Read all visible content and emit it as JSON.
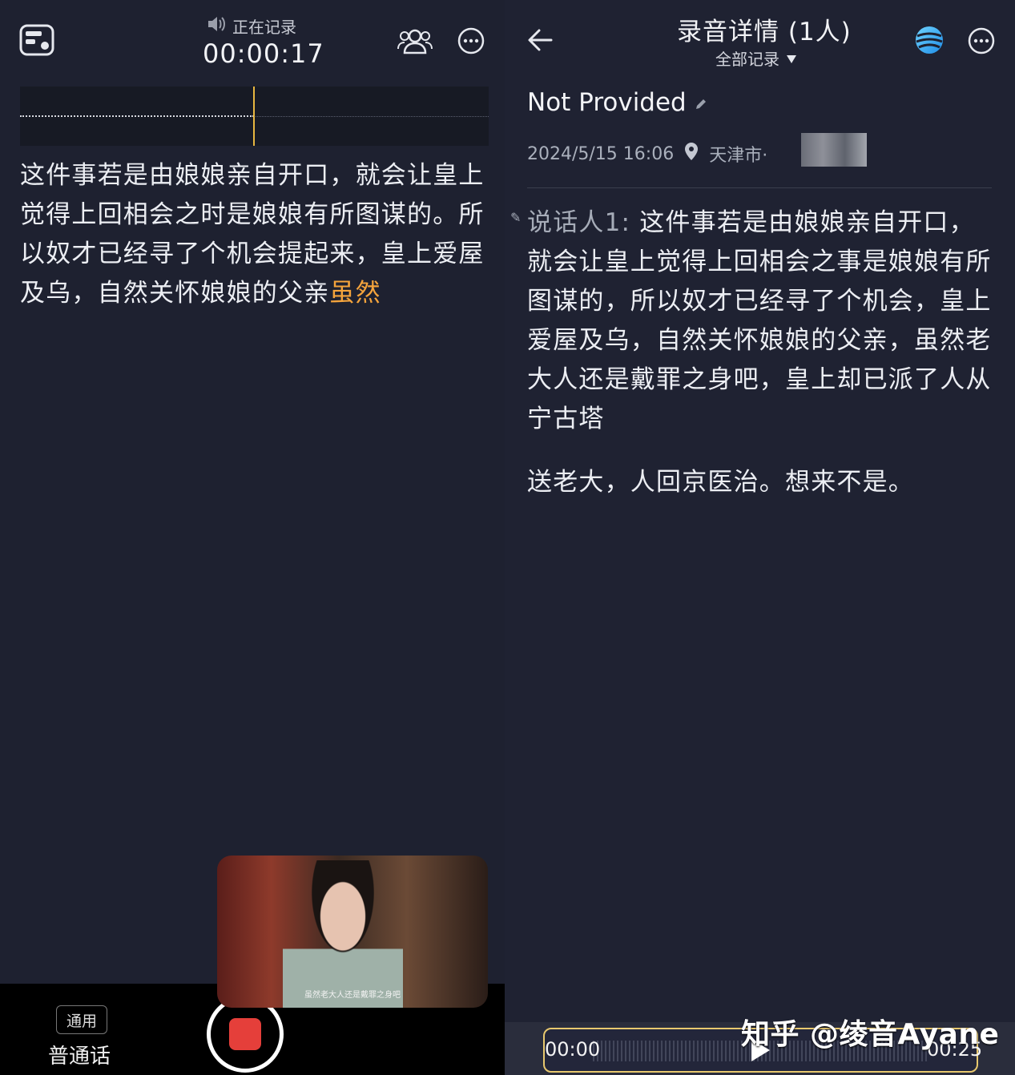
{
  "left": {
    "status": "正在记录",
    "timer": "00:00:17",
    "live_text": "这件事若是由娘娘亲自开口，就会让皇上觉得上回相会之时是娘娘有所图谋的。所以奴才已经寻了个机会提起来，皇上爱屋及乌，自然关怀娘娘的父亲",
    "live_text_highlight": "虽然",
    "language_badge": "通用",
    "language": "普通话",
    "video_subtitle": "虽然老大人还是戴罪之身吧"
  },
  "right": {
    "title": "录音详情 (1人)",
    "filter": "全部记录",
    "name": "Not Provided",
    "datetime": "2024/5/15 16:06",
    "location": "天津市·",
    "speaker_label": "说话人1:",
    "transcript": "这件事若是由娘娘亲自开口，就会让皇上觉得上回相会之事是娘娘有所图谋的，所以奴才已经寻了个机会，皇上爱屋及乌，自然关怀娘娘的父亲，虽然老大人还是戴罪之身吧，皇上却已派了人从宁古塔",
    "transcript2": "送老大，人回京医治。想来不是。",
    "player_start": "00:00",
    "player_end": "00:25"
  },
  "watermark": "知乎 @绫音Ayane",
  "colors": {
    "background": "#1e2130",
    "highlight": "#f5a43c",
    "record": "#e53f3a",
    "timeline_cursor": "#e7b640"
  },
  "icons": [
    "layout-icon",
    "speaker-icon",
    "people-icon",
    "more-icon",
    "back-icon",
    "ai-assistant-icon",
    "location-pin-icon",
    "edit-icon",
    "dropdown-triangle-icon",
    "play-icon"
  ]
}
